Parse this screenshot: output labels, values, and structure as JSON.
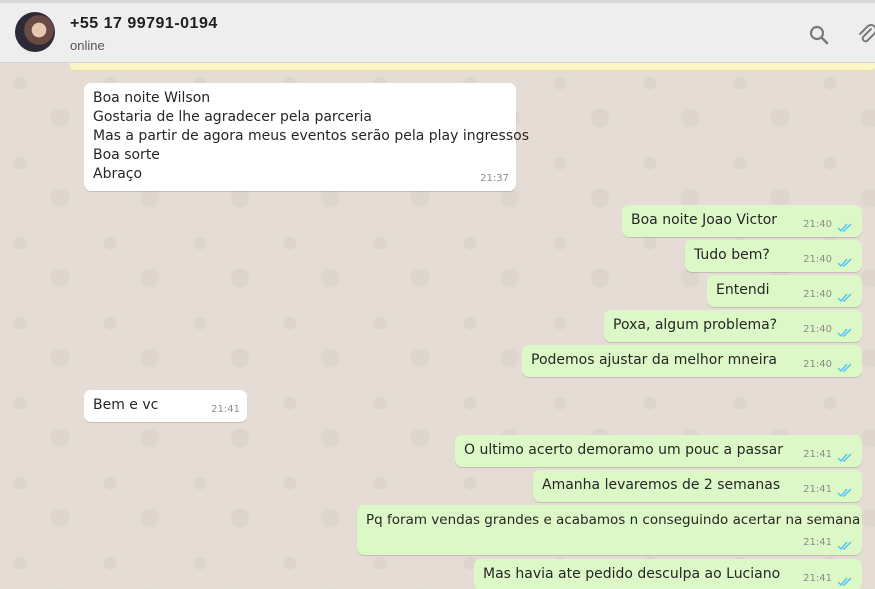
{
  "header": {
    "contact_name": "+55 17 99791-0194",
    "status": "online",
    "icons": [
      "avatar",
      "search-icon",
      "attach-icon"
    ]
  },
  "colors": {
    "incoming_bubble": "#ffffff",
    "outgoing_bubble": "#dcf8c6",
    "read_ticks": "#4fc3f7",
    "chat_background": "#e5ddd5"
  },
  "messages": [
    {
      "dir": "in",
      "text": "Boa noite Wilson\nGostaria de lhe agradecer pela parceria\nMas a partir de agora meus eventos serão pela play ingressos\nBoa sorte\nAbraço",
      "time": "21:37"
    },
    {
      "dir": "out",
      "text": "Boa noite Joao Victor",
      "time": "21:40"
    },
    {
      "dir": "out",
      "text": "Tudo bem?",
      "time": "21:40"
    },
    {
      "dir": "out",
      "text": "Entendi",
      "time": "21:40"
    },
    {
      "dir": "out",
      "text": "Poxa, algum problema?",
      "time": "21:40"
    },
    {
      "dir": "out",
      "text": "Podemos ajustar da melhor mneira",
      "time": "21:40"
    },
    {
      "dir": "in",
      "text": "Bem e vc",
      "time": "21:41"
    },
    {
      "dir": "out",
      "text": "O ultimo acerto demoramo um pouc a passar",
      "time": "21:41"
    },
    {
      "dir": "out",
      "text": "Amanha levaremos de 2 semanas",
      "time": "21:41"
    },
    {
      "dir": "out",
      "text": "Pq foram vendas grandes e acabamos n conseguindo acertar na semana",
      "time": "21:41"
    },
    {
      "dir": "out",
      "text": "Mas havia ate pedido desculpa ao Luciano",
      "time": "21:41"
    }
  ]
}
